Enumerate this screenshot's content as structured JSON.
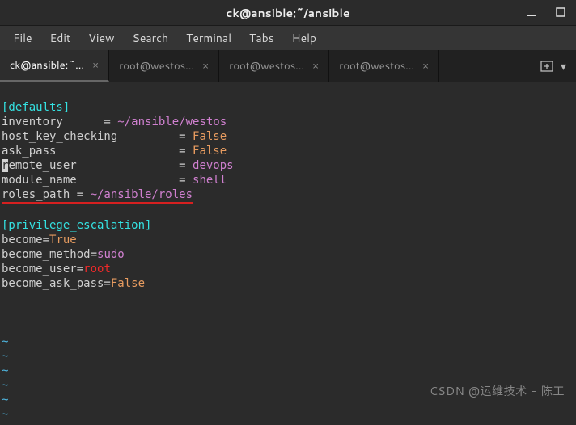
{
  "window": {
    "title": "ck@ansible:~/ansible"
  },
  "menu": {
    "file": "File",
    "edit": "Edit",
    "view": "View",
    "search": "Search",
    "terminal": "Terminal",
    "tabs": "Tabs",
    "help": "Help"
  },
  "tabs": [
    {
      "label": "ck@ansible:~...",
      "active": true
    },
    {
      "label": "root@westos...",
      "active": false
    },
    {
      "label": "root@westos...",
      "active": false
    },
    {
      "label": "root@westos...",
      "active": false
    }
  ],
  "content": {
    "section1": "[defaults]",
    "line1_key": "inventory      = ",
    "line1_val": "~/ansible/westos",
    "line2_key": "host_key_checking         = ",
    "line2_val": "False",
    "line3_key": "ask_pass                  = ",
    "line3_val": "False",
    "line4_first": "r",
    "line4_key": "emote_user               = ",
    "line4_val": "devops",
    "line5_key": "module_name               = ",
    "line5_val": "shell",
    "line6_key": "roles_path = ",
    "line6_val": "~/ansible/roles",
    "section2": "[privilege_escalation]",
    "line7_key": "become=",
    "line7_val": "True",
    "line8_key": "become_method=",
    "line8_val": "sudo",
    "line9_key": "become_user=",
    "line9_val": "root",
    "line10_key": "become_ask_pass=",
    "line10_val": "False",
    "tilde": "~"
  },
  "watermark": "CSDN @运维技术 - 陈工"
}
